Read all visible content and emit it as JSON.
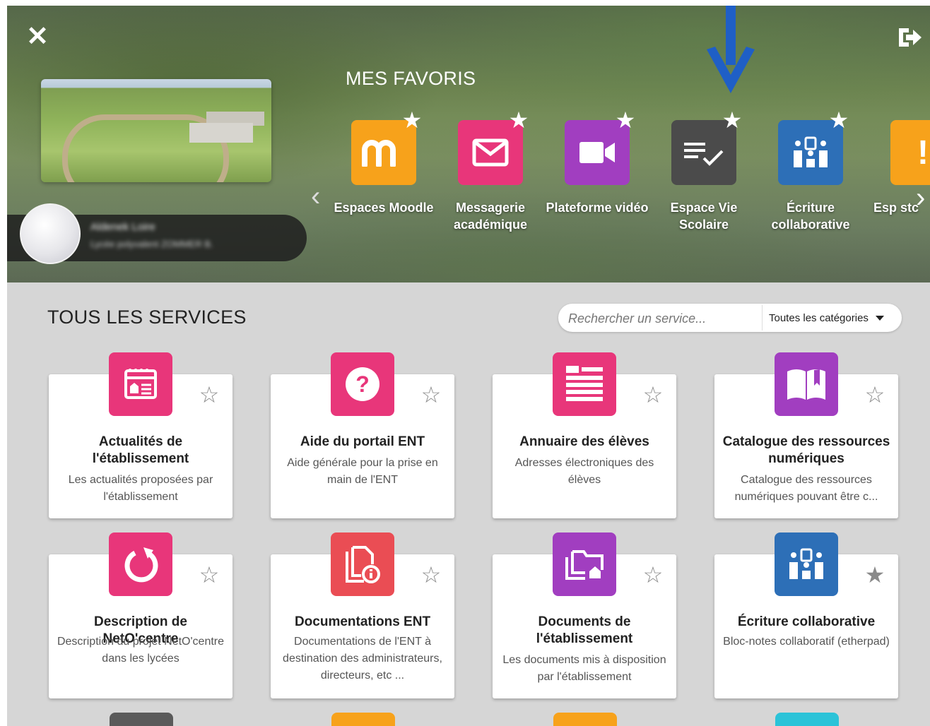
{
  "hero": {
    "favorites_title": "MES FAVORIS",
    "user_name": "Aldenek Loire",
    "user_school": "Lycée polyvalent ZOMMER B."
  },
  "favorites": [
    {
      "label": "Espaces Moodle",
      "color": "#f7a21b",
      "icon": "moodle-icon"
    },
    {
      "label": "Messagerie académique",
      "color": "#e8367a",
      "icon": "mail-icon"
    },
    {
      "label": "Plateforme vidéo",
      "color": "#a13ec0",
      "icon": "video-camera-icon"
    },
    {
      "label": "Espace Vie Scolaire",
      "color": "#4b4b4b",
      "icon": "checklist-icon"
    },
    {
      "label": "Écriture collaborative",
      "color": "#2d6fb7",
      "icon": "collaboration-icon"
    },
    {
      "label": "Esp stc",
      "color": "#f7a21b",
      "icon": "alert-icon"
    }
  ],
  "services": {
    "title": "TOUS LES SERVICES",
    "search_placeholder": "Rechercher un service...",
    "category_selected": "Toutes les catégories",
    "cards": [
      {
        "title": "Actualités de l'établissement",
        "desc": "Les actualités proposées par l'établissement",
        "color": "#e8367a",
        "icon": "news-icon",
        "favorite": false
      },
      {
        "title": "Aide du portail ENT",
        "desc": "Aide générale pour la prise en main de l'ENT",
        "color": "#e8367a",
        "icon": "help-icon",
        "favorite": false
      },
      {
        "title": "Annuaire des élèves",
        "desc": "Adresses électroniques des élèves",
        "color": "#e8367a",
        "icon": "directory-icon",
        "favorite": false
      },
      {
        "title": "Catalogue des ressources numériques",
        "desc": "Catalogue des ressources numériques pouvant être c...",
        "color": "#a13ec0",
        "icon": "book-icon",
        "favorite": false
      },
      {
        "title": "Description de NetO'centre",
        "desc": "Description du projet NetO'centre dans les lycées",
        "color": "#e8367a",
        "icon": "refresh-icon",
        "favorite": false
      },
      {
        "title": "Documentations ENT",
        "desc": "Documentations de l'ENT à destination des administrateurs, directeurs, etc ...",
        "color": "#ea4d54",
        "icon": "document-info-icon",
        "favorite": false
      },
      {
        "title": "Documents de l'établissement",
        "desc": "Les documents mis à disposition par l'établissement",
        "color": "#a13ec0",
        "icon": "folder-icon",
        "favorite": false
      },
      {
        "title": "Écriture collaborative",
        "desc": "Bloc-notes collaboratif (etherpad)",
        "color": "#2d6fb7",
        "icon": "collaboration-icon",
        "favorite": true
      }
    ],
    "next_row_colors": [
      "#5a5a5a",
      "#f7a21b",
      "#f7a21b",
      "#2bc3d8"
    ]
  }
}
